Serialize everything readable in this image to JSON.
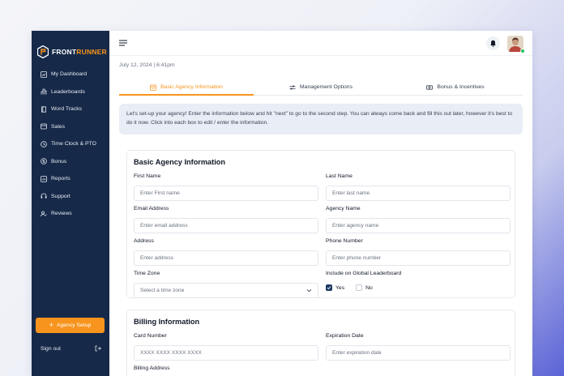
{
  "app": {
    "brand_part1": "FRONT",
    "brand_part2": "RUNNER",
    "accent_color": "#f7941d",
    "sidebar_color": "#162948"
  },
  "sidebar": {
    "items": [
      {
        "label": "My Dashboard",
        "icon": "dashboard-icon"
      },
      {
        "label": "Leaderboards",
        "icon": "leaderboard-icon"
      },
      {
        "label": "Word Tracks",
        "icon": "book-icon"
      },
      {
        "label": "Sales",
        "icon": "sales-icon"
      },
      {
        "label": "Time Clock & PTO",
        "icon": "clock-icon"
      },
      {
        "label": "Bonus",
        "icon": "dollar-icon"
      },
      {
        "label": "Reports",
        "icon": "reports-icon"
      },
      {
        "label": "Support",
        "icon": "support-icon"
      },
      {
        "label": "Reviews",
        "icon": "reviews-icon"
      }
    ],
    "agency_button": "Agency Setup",
    "signout": "Sign out"
  },
  "header": {
    "date": "July 12, 2024 | 6:41pm"
  },
  "tabs": [
    {
      "label": "Basic Agency Information",
      "icon": "building-icon",
      "active": true
    },
    {
      "label": "Management Options",
      "icon": "sliders-icon",
      "active": false
    },
    {
      "label": "Bonus & Incentives",
      "icon": "money-icon",
      "active": false
    }
  ],
  "banner": "Let's set-up your agency! Enter the information below and hit \"next\" to go to the second step. You can always come back and fill this out later, however it's best to do it now. Click into each box to edit / enter the information.",
  "basic_info": {
    "title": "Basic Agency Information",
    "first_name": {
      "label": "First Name",
      "placeholder": "Enter First name"
    },
    "last_name": {
      "label": "Last Name",
      "placeholder": "Enter last name"
    },
    "email": {
      "label": "Email Address",
      "placeholder": "Enter email address"
    },
    "agency_name": {
      "label": "Agency Name",
      "placeholder": "Enter agency name"
    },
    "address": {
      "label": "Address",
      "placeholder": "Enter address"
    },
    "phone": {
      "label": "Phone Number",
      "placeholder": "Enter phone number"
    },
    "time_zone": {
      "label": "Time Zone",
      "placeholder": "Select a time zone"
    },
    "global_leaderboard": {
      "label": "Include on Global Leaderboard",
      "yes": "Yes",
      "no": "No",
      "selected": "Yes"
    }
  },
  "billing": {
    "title": "Billing Information",
    "card_number": {
      "label": "Card Number",
      "placeholder": "XXXX  XXXX  XXXX  XXXX"
    },
    "expiration": {
      "label": "Expiration Date",
      "placeholder": "Enter expiration date"
    },
    "billing_address": {
      "label": "Billing Address"
    }
  }
}
